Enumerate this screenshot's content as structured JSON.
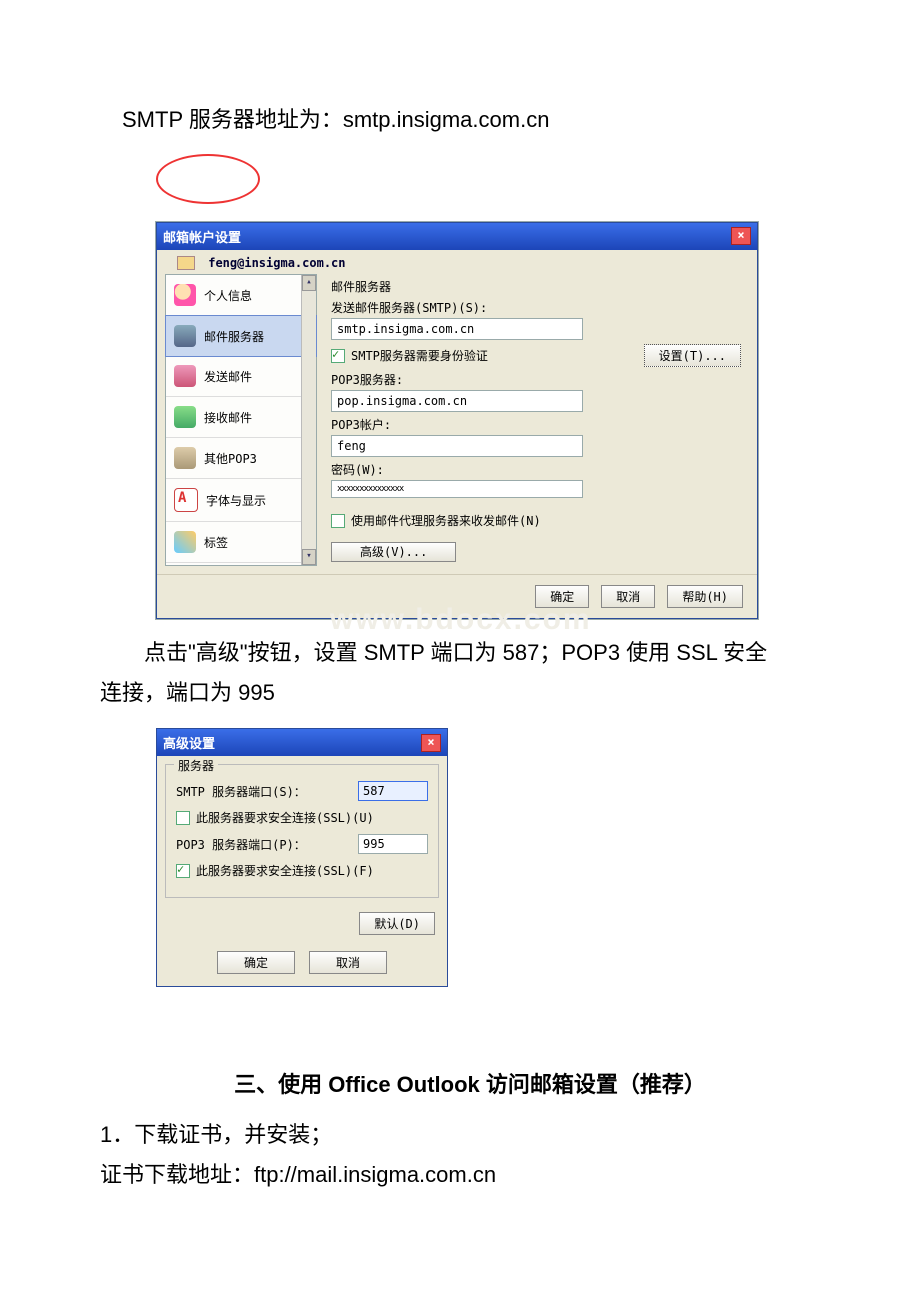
{
  "doc": {
    "line1": "SMTP 服务器地址为：smtp.insigma.com.cn",
    "para2_a": "点击\"高级\"按钮，设置 SMTP 端口为 587；POP3 使用 SSL 安全",
    "para2_b": "连接，端口为 995",
    "section3": "三、使用 Office Outlook 访问邮箱设置（推荐）",
    "step1": "1．下载证书，并安装；",
    "certline": "证书下载地址：ftp://mail.insigma.com.cn",
    "watermark": "www.bdocx.com"
  },
  "dlg1": {
    "title": "邮箱帐户设置",
    "account": "feng@insigma.com.cn",
    "sidebar": [
      "个人信息",
      "邮件服务器",
      "发送邮件",
      "接收邮件",
      "其他POP3",
      "字体与显示",
      "标签"
    ],
    "grp_title": "邮件服务器",
    "smtp_label": "发送邮件服务器(SMTP)(S):",
    "smtp_value": "smtp.insigma.com.cn",
    "smtp_auth": "SMTP服务器需要身份验证",
    "set_btn": "设置(T)...",
    "pop3_label": "POP3服务器:",
    "pop3_value": "pop.insigma.com.cn",
    "pop3_acct_label": "POP3帐户:",
    "pop3_acct_value": "feng",
    "pwd_label": "密码(W):",
    "pwd_value": "xxxxxxxxxxxxxxx",
    "proxy_label": "使用邮件代理服务器来收发邮件(N)",
    "adv_btn": "高级(V)...",
    "ok": "确定",
    "cancel": "取消",
    "help": "帮助(H)"
  },
  "dlg2": {
    "title": "高级设置",
    "legend": "服务器",
    "smtp_port_label": "SMTP 服务器端口(S)：",
    "smtp_port": "587",
    "ssl_u": "此服务器要求安全连接(SSL)(U)",
    "pop3_port_label": "POP3 服务器端口(P)：",
    "pop3_port": "995",
    "ssl_f": "此服务器要求安全连接(SSL)(F)",
    "default_btn": "默认(D)",
    "ok": "确定",
    "cancel": "取消"
  }
}
